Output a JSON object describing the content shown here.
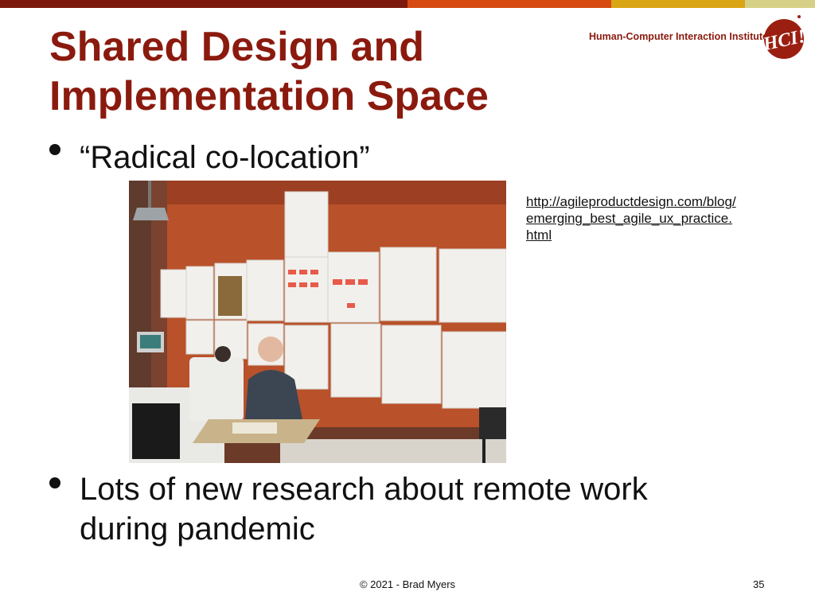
{
  "slide": {
    "title_line1": "Shared Design and",
    "title_line2": "Implementation Space",
    "logo_text": "Human-Computer Interaction Institute",
    "logo_mark": "HCI!",
    "bullet1": "“Radical co-location”",
    "bullet2_line1": "Lots of new research about remote work",
    "bullet2_line2": "during pandemic",
    "link_line1": "http://agileproductdesign.com/blog/",
    "link_line2": "emerging_best_agile_ux_practice.",
    "link_line3": "html",
    "footer": "© 2021 - Brad Myers",
    "page_number": "35"
  },
  "colors": {
    "title": "#8b1a0e",
    "bar_dark_red": "#7b1a0c",
    "bar_orange": "#d64a12",
    "bar_gold": "#d9a514",
    "bar_khaki": "#d6cf86"
  }
}
